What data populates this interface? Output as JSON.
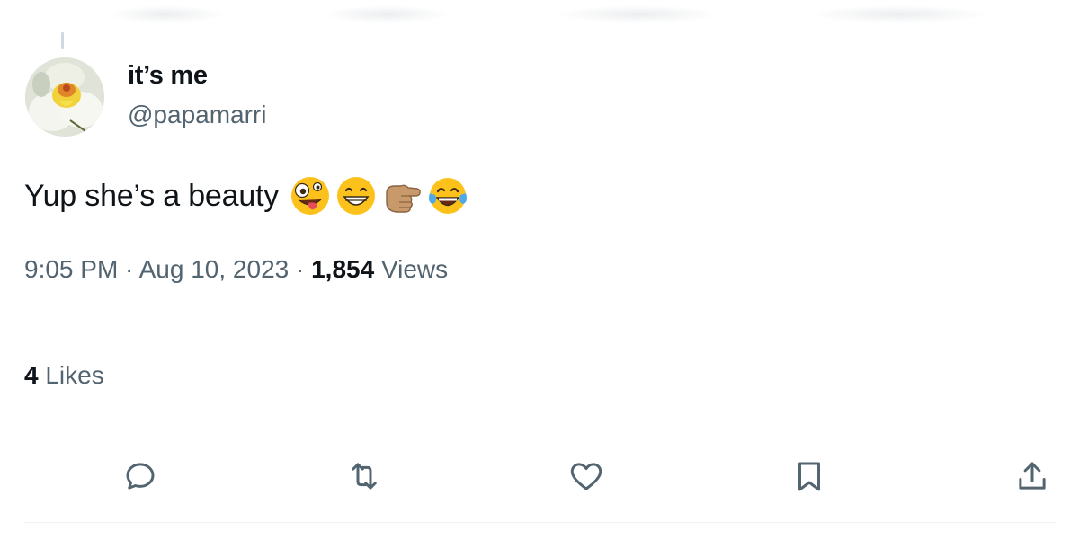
{
  "tweet": {
    "author": {
      "display_name": "it’s me",
      "handle": "@papamarri"
    },
    "text": "Yup she’s a beauty",
    "emojis": [
      "zany-face",
      "grinning-face",
      "backhand-index-pointing-right-medium-skin",
      "face-with-tears-of-joy"
    ],
    "time": "9:05 PM",
    "separator": " · ",
    "date": "Aug 10, 2023",
    "views_count": "1,854",
    "views_label": "Views",
    "likes_count": "4",
    "likes_label": "Likes"
  },
  "actions": [
    {
      "name": "reply",
      "icon": "reply-icon"
    },
    {
      "name": "retweet",
      "icon": "retweet-icon"
    },
    {
      "name": "like",
      "icon": "heart-icon"
    },
    {
      "name": "bookmark",
      "icon": "bookmark-icon"
    },
    {
      "name": "share",
      "icon": "share-icon"
    }
  ],
  "colors": {
    "text_primary": "#0f1419",
    "text_secondary": "#536471",
    "divider": "#eff3f4",
    "icon": "#536471",
    "thread_line": "#cfd9de"
  }
}
